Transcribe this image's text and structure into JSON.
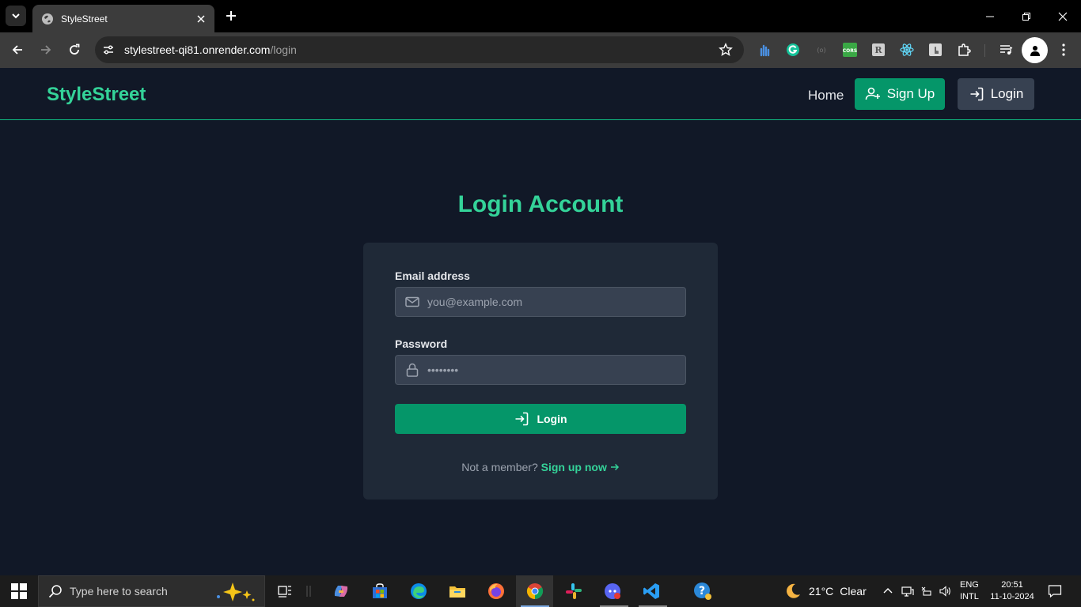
{
  "browser": {
    "tab_title": "StyleStreet",
    "url_host": "stylestreet-qi81.onrender.com",
    "url_path": "/login"
  },
  "site": {
    "brand": "StyleStreet",
    "nav": {
      "home": "Home",
      "signup": "Sign Up",
      "login": "Login"
    }
  },
  "login": {
    "heading": "Login Account",
    "email_label": "Email address",
    "email_placeholder": "you@example.com",
    "password_label": "Password",
    "password_value": "••••••••",
    "submit_label": "Login",
    "footer_text": "Not a member?",
    "footer_link": "Sign up now"
  },
  "taskbar": {
    "search_placeholder": "Type here to search",
    "weather_temp": "21°C",
    "weather_desc": "Clear",
    "lang_line1": "ENG",
    "lang_line2": "INTL",
    "time": "20:51",
    "date": "11-10-2024"
  },
  "colors": {
    "accent": "#34d399",
    "button_green": "#059669",
    "page_bg": "#111827",
    "card_bg": "#1f2937"
  }
}
